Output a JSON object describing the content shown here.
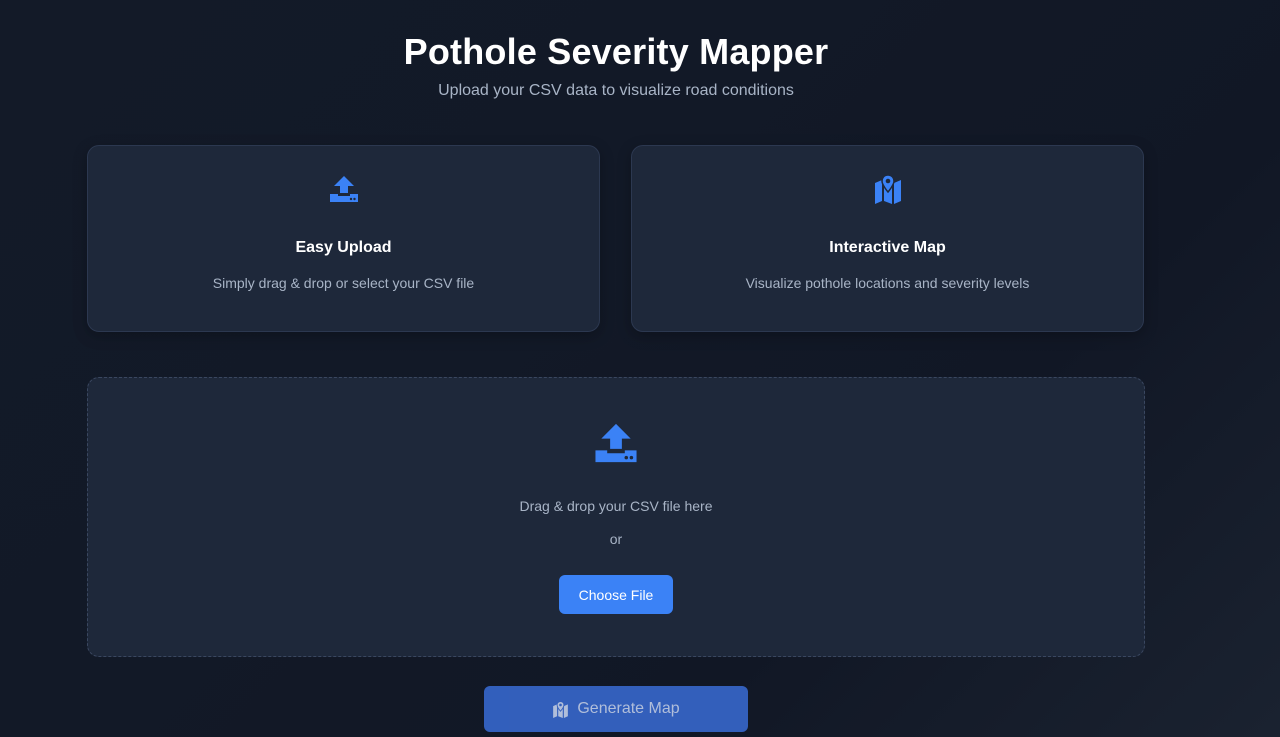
{
  "header": {
    "title": "Pothole Severity Mapper",
    "subtitle": "Upload your CSV data to visualize road conditions"
  },
  "features": [
    {
      "icon": "upload-icon",
      "title": "Easy Upload",
      "description": "Simply drag & drop or select your CSV file"
    },
    {
      "icon": "map-marker-icon",
      "title": "Interactive Map",
      "description": "Visualize pothole locations and severity levels"
    }
  ],
  "dropzone": {
    "icon": "upload-icon",
    "prompt": "Drag & drop your CSV file here",
    "or_text": "or",
    "choose_label": "Choose File"
  },
  "generate": {
    "icon": "map-marker-icon",
    "label": "Generate Map",
    "enabled": false
  },
  "colors": {
    "accent": "#3b82f6",
    "card_bg": "#1e283a",
    "muted_text": "#a8b4c6"
  }
}
